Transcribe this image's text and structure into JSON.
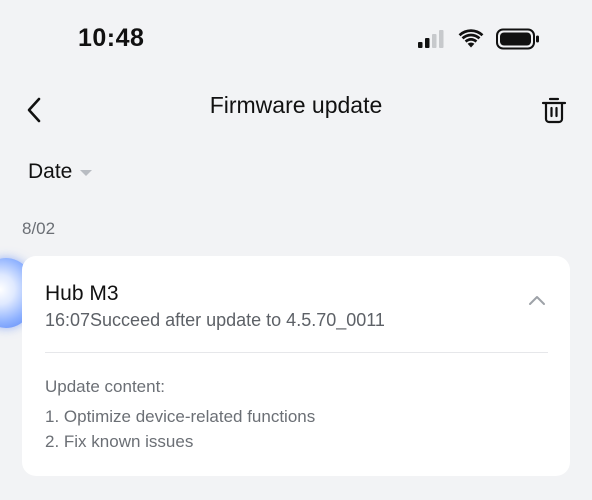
{
  "status_bar": {
    "time": "10:48",
    "icons": [
      "cellular-signal-icon",
      "wifi-icon",
      "battery-icon"
    ]
  },
  "header": {
    "title": "Firmware update",
    "back_icon": "chevron-left-icon",
    "delete_icon": "trash-icon"
  },
  "filter": {
    "label": "Date",
    "icon": "caret-down-icon"
  },
  "groups": [
    {
      "date": "8/02",
      "entries": [
        {
          "device": "Hub M3",
          "status_line": "16:07Succeed after update to 4.5.70_0011",
          "expanded": true,
          "content_heading": "Update content:",
          "content_items": [
            "1. Optimize device-related functions",
            "2. Fix known issues"
          ]
        }
      ]
    }
  ],
  "colors": {
    "background": "#f2f3f5",
    "card": "#ffffff",
    "text_primary": "#111111",
    "text_secondary": "#6b6f75",
    "divider": "#e6e7ea",
    "bubble_accent": "#4f7df5"
  }
}
